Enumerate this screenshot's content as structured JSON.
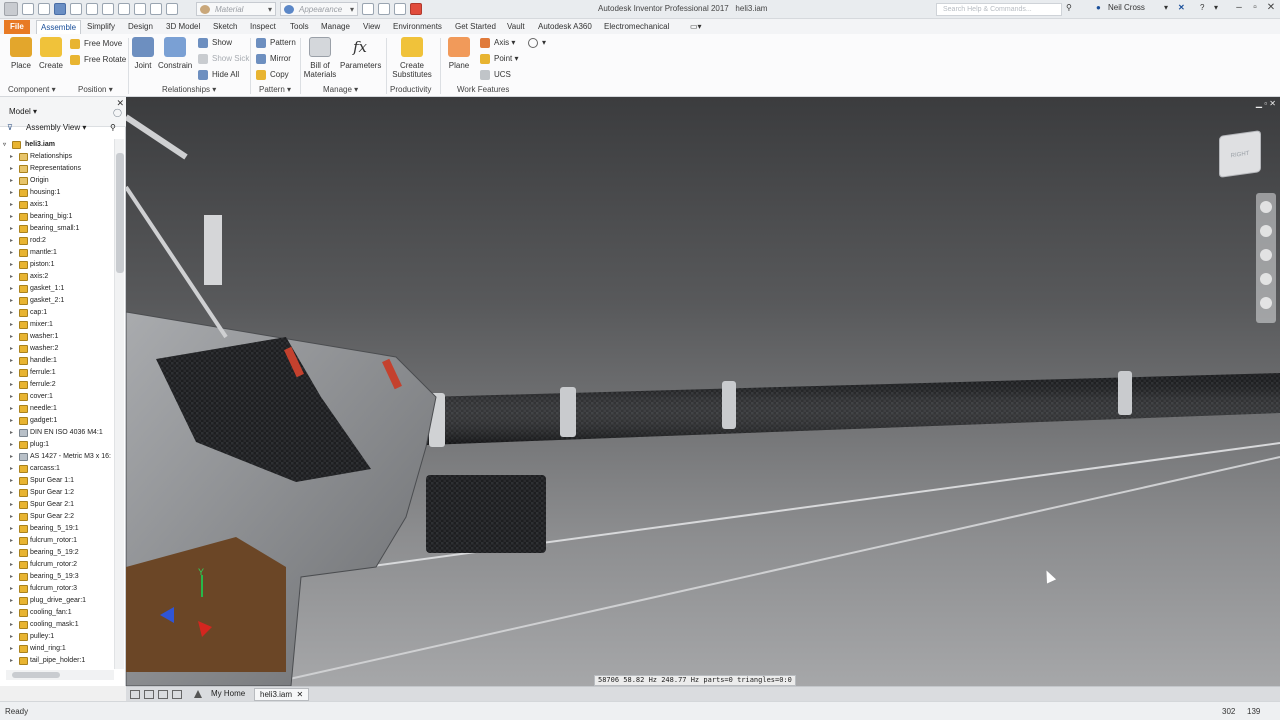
{
  "app": {
    "title": "Autodesk Inventor Professional 2017",
    "document": "heli3.iam",
    "search_placeholder": "Search Help & Commands...",
    "user": "Neil Cross",
    "material_placeholder": "Material",
    "appearance_placeholder": "Appearance"
  },
  "tabs": [
    "File",
    "Assemble",
    "Simplify",
    "Design",
    "3D Model",
    "Sketch",
    "Inspect",
    "Tools",
    "Manage",
    "View",
    "Environments",
    "Get Started",
    "Vault",
    "Autodesk A360",
    "Electromechanical"
  ],
  "active_tab": "Assemble",
  "ribbon": {
    "place": "Place",
    "create": "Create",
    "free_move": "Free Move",
    "free_rotate": "Free Rotate",
    "joint": "Joint",
    "constrain": "Constrain",
    "show": "Show",
    "show_sick": "Show Sick",
    "hide_all": "Hide All",
    "pattern": "Pattern",
    "mirror": "Mirror",
    "copy": "Copy",
    "bill_of_materials_1": "Bill of",
    "bill_of_materials_2": "Materials",
    "parameters": "Parameters",
    "parameters_icon": "fx",
    "create_substitutes_1": "Create",
    "create_substitutes_2": "Substitutes",
    "plane": "Plane",
    "axis": "Axis",
    "point": "Point",
    "ucs": "UCS",
    "panels": {
      "component": "Component",
      "position": "Position",
      "relationships": "Relationships",
      "pattern": "Pattern",
      "manage": "Manage",
      "productivity": "Productivity",
      "work_features": "Work Features"
    }
  },
  "browser": {
    "title": "Model",
    "view": "Assembly View",
    "root": "heli3.iam",
    "items": [
      {
        "label": "Relationships",
        "icon": "folder"
      },
      {
        "label": "Representations",
        "icon": "folder"
      },
      {
        "label": "Origin",
        "icon": "folder"
      },
      {
        "label": "housing:1",
        "icon": "part"
      },
      {
        "label": "axis:1",
        "icon": "part"
      },
      {
        "label": "bearing_big:1",
        "icon": "part"
      },
      {
        "label": "bearing_small:1",
        "icon": "part"
      },
      {
        "label": "rod:2",
        "icon": "part"
      },
      {
        "label": "mantle:1",
        "icon": "part"
      },
      {
        "label": "piston:1",
        "icon": "part"
      },
      {
        "label": "axis:2",
        "icon": "part"
      },
      {
        "label": "gasket_1:1",
        "icon": "part"
      },
      {
        "label": "gasket_2:1",
        "icon": "part"
      },
      {
        "label": "cap:1",
        "icon": "part"
      },
      {
        "label": "mixer:1",
        "icon": "part"
      },
      {
        "label": "washer:1",
        "icon": "part"
      },
      {
        "label": "washer:2",
        "icon": "part"
      },
      {
        "label": "handle:1",
        "icon": "part"
      },
      {
        "label": "ferrule:1",
        "icon": "part"
      },
      {
        "label": "ferrule:2",
        "icon": "part"
      },
      {
        "label": "cover:1",
        "icon": "part"
      },
      {
        "label": "needle:1",
        "icon": "part"
      },
      {
        "label": "gadget:1",
        "icon": "part"
      },
      {
        "label": "DIN EN ISO 4036 M4:1",
        "icon": "bolt"
      },
      {
        "label": "plug:1",
        "icon": "part"
      },
      {
        "label": "AS 1427 - Metric M3 x 16:",
        "icon": "bolt"
      },
      {
        "label": "carcass:1",
        "icon": "part"
      },
      {
        "label": "Spur Gear 1:1",
        "icon": "part"
      },
      {
        "label": "Spur Gear 1:2",
        "icon": "part"
      },
      {
        "label": "Spur Gear 2:1",
        "icon": "part"
      },
      {
        "label": "Spur Gear 2:2",
        "icon": "part"
      },
      {
        "label": "bearing_5_19:1",
        "icon": "part"
      },
      {
        "label": "fulcrum_rotor:1",
        "icon": "part"
      },
      {
        "label": "bearing_5_19:2",
        "icon": "part"
      },
      {
        "label": "fulcrum_rotor:2",
        "icon": "part"
      },
      {
        "label": "bearing_5_19:3",
        "icon": "part"
      },
      {
        "label": "fulcrum_rotor:3",
        "icon": "part"
      },
      {
        "label": "plug_drive_gear:1",
        "icon": "part"
      },
      {
        "label": "cooling_fan:1",
        "icon": "part"
      },
      {
        "label": "cooling_mask:1",
        "icon": "part"
      },
      {
        "label": "pulley:1",
        "icon": "part"
      },
      {
        "label": "wind_ring:1",
        "icon": "part"
      },
      {
        "label": "tail_pipe_holder:1",
        "icon": "part"
      }
    ]
  },
  "viewport": {
    "perf_text": "58706  58.82 Hz 248.77 Hz  parts=0 triangles=0:0",
    "viewcube_face": "RIGHT",
    "axis_labels": {
      "y": "Y"
    }
  },
  "doc_tabs": {
    "home": "My Home",
    "active": "heli3.iam"
  },
  "status": {
    "text": "Ready",
    "num1": "302",
    "num2": "139"
  },
  "colors": {
    "file_tab": "#e87a24",
    "accent": "#1a4f9a"
  }
}
